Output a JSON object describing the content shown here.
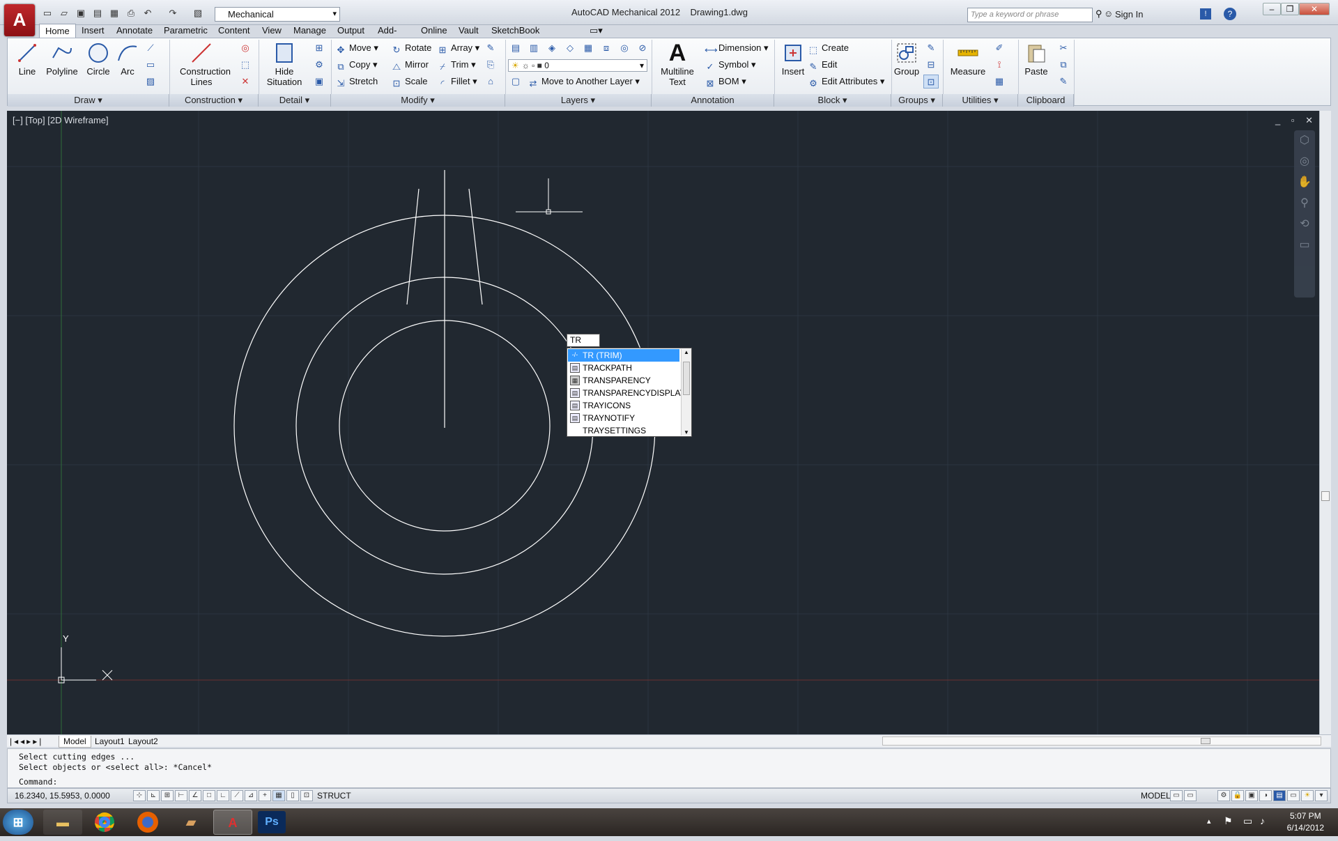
{
  "titlebar": {
    "app_letter": "A",
    "workspace": "Mechanical",
    "app_name": "AutoCAD Mechanical 2012",
    "file_name": "Drawing1.dwg",
    "search_placeholder": "Type a keyword or phrase",
    "sign_in": "Sign In",
    "help_icon": "?"
  },
  "tabs": [
    "Home",
    "Insert",
    "Annotate",
    "Parametric",
    "Content",
    "View",
    "Manage",
    "Output",
    "Add-Ins",
    "Online",
    "Vault",
    "SketchBook Designer"
  ],
  "ribbon": {
    "draw": {
      "title": "Draw",
      "line": "Line",
      "polyline": "Polyline",
      "circle": "Circle",
      "arc": "Arc"
    },
    "construction": {
      "title": "Construction",
      "lines": "Construction Lines"
    },
    "detail": {
      "title": "Detail",
      "hide": "Hide Situation"
    },
    "modify": {
      "title": "Modify",
      "move": "Move",
      "rotate": "Rotate",
      "array": "Array",
      "copy": "Copy",
      "mirror": "Mirror",
      "trim": "Trim",
      "stretch": "Stretch",
      "scale": "Scale",
      "fillet": "Fillet"
    },
    "layers": {
      "title": "Layers",
      "current_layer": "0",
      "move_layer": "Move to Another Layer"
    },
    "annotation": {
      "title": "Annotation",
      "mtext": "Multiline Text",
      "dimension": "Dimension",
      "symbol": "Symbol",
      "bom": "BOM"
    },
    "block": {
      "title": "Block",
      "insert": "Insert",
      "create": "Create",
      "edit": "Edit",
      "edit_attr": "Edit Attributes"
    },
    "groups": {
      "title": "Groups",
      "group": "Group"
    },
    "utilities": {
      "title": "Utilities",
      "measure": "Measure"
    },
    "clipboard": {
      "title": "Clipboard",
      "paste": "Paste"
    }
  },
  "viewport": {
    "label": "[−] [Top] [2D Wireframe]",
    "controls": "_ ▫ ✕",
    "axis_x": "X",
    "axis_y": "Y"
  },
  "autocomplete": {
    "input": "TR",
    "items": [
      {
        "label": "TR (TRIM)",
        "selected": true
      },
      {
        "label": "TRACKPATH",
        "selected": false
      },
      {
        "label": "TRANSPARENCY",
        "selected": false
      },
      {
        "label": "TRANSPARENCYDISPLAY",
        "selected": false
      },
      {
        "label": "TRAYICONS",
        "selected": false
      },
      {
        "label": "TRAYNOTIFY",
        "selected": false
      },
      {
        "label": "TRAYSETTINGS",
        "selected": false
      }
    ]
  },
  "layout_tabs": [
    "Model",
    "Layout1",
    "Layout2"
  ],
  "command_line": {
    "line1": "Select cutting edges ...",
    "line2": "Select objects or <select all>: *Cancel*",
    "prompt": "Command:"
  },
  "status": {
    "coords": "16.2340, 15.5953, 0.0000",
    "struct": "STRUCT",
    "model": "MODEL"
  },
  "taskbar": {
    "time": "5:07 PM",
    "date": "6/14/2012",
    "ps_label": "Ps"
  }
}
